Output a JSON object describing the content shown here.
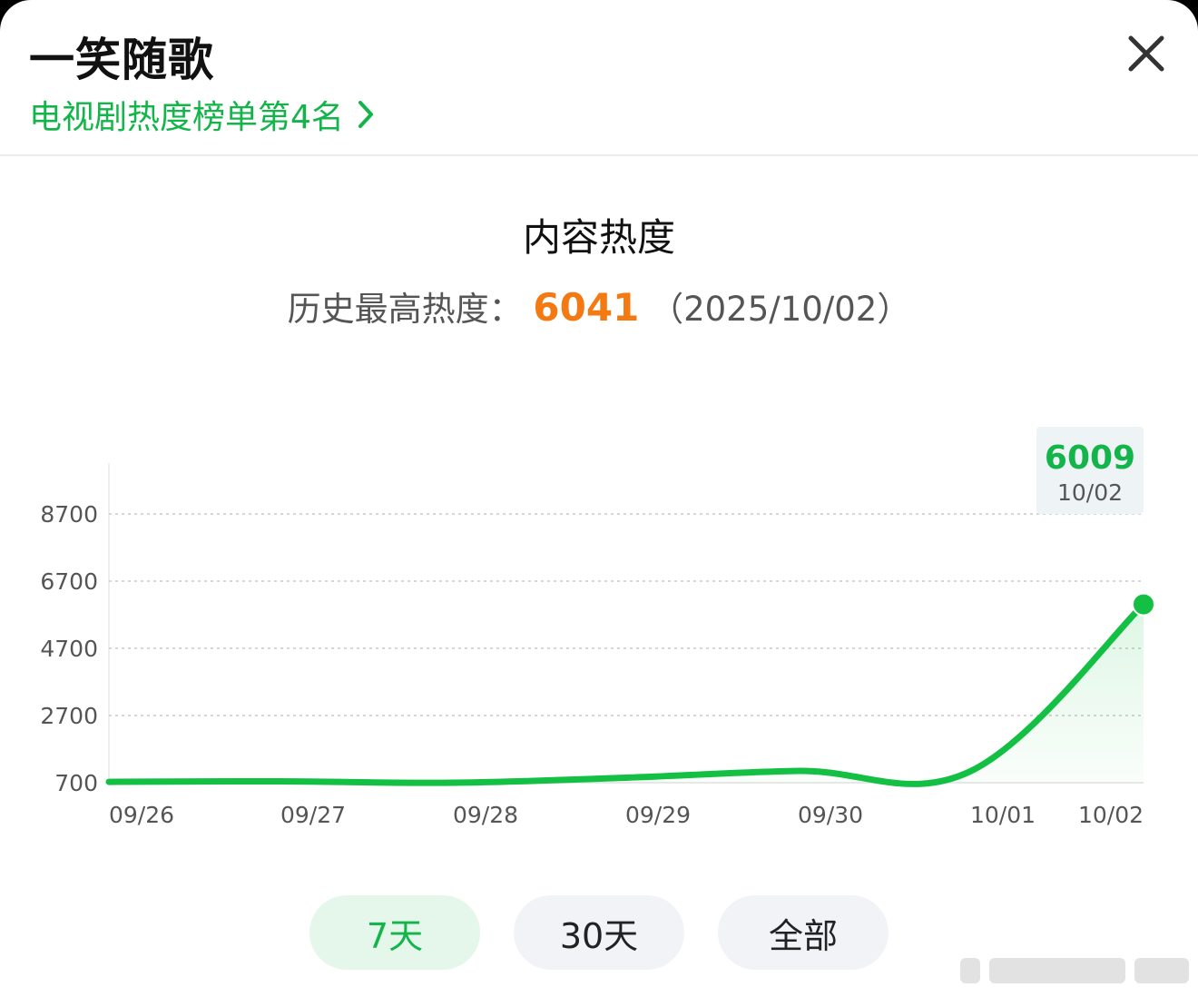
{
  "header": {
    "title": "一笑随歌",
    "rank_link": "电视剧热度榜单第4名"
  },
  "summary": {
    "chart_title": "内容热度",
    "peak_label": "历史最高热度：",
    "peak_value": "6041",
    "peak_date": "（2025/10/02）"
  },
  "tooltip": {
    "value": "6009",
    "date": "10/02"
  },
  "range_tabs": [
    {
      "label": "7天",
      "active": true
    },
    {
      "label": "30天",
      "active": false
    },
    {
      "label": "全部",
      "active": false
    }
  ],
  "colors": {
    "accent": "#13b54a",
    "peak": "#f37a12",
    "line": "#14c043"
  },
  "chart_data": {
    "type": "area",
    "x": [
      "09/26",
      "09/27",
      "09/28",
      "09/29",
      "09/30",
      "10/01",
      "10/02"
    ],
    "series": [
      {
        "values": [
          725,
          740,
          700,
          850,
          1050,
          1050,
          6009
        ]
      }
    ],
    "yticks": [
      700,
      2700,
      4700,
      6700,
      8700
    ],
    "ylim": [
      700,
      9500
    ],
    "grid": true
  }
}
